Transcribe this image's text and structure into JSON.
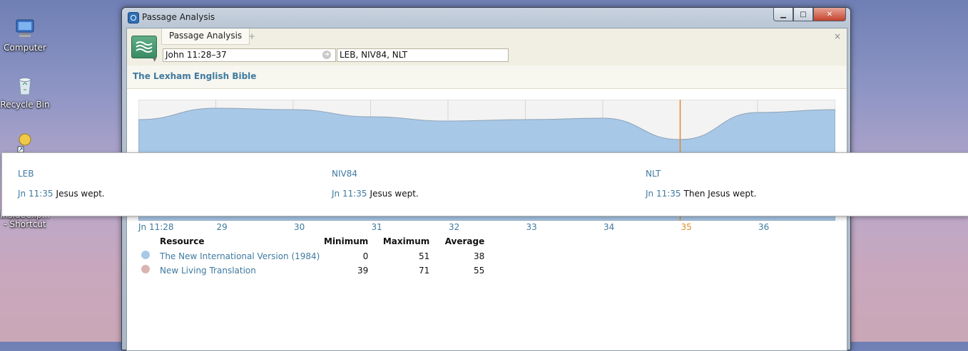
{
  "desktop": {
    "icons": [
      {
        "label": "Computer",
        "icon": "computer-icon"
      },
      {
        "label": "Recycle Bin",
        "icon": "recycle-bin-icon"
      },
      {
        "label": "InsideClip... - Shortcut",
        "icon": "shortcut-icon"
      }
    ]
  },
  "window": {
    "title": "Passage Analysis",
    "tab_label": "Passage Analysis",
    "tab_add": "+",
    "tab_close": "×",
    "reference_value": "John 11:28–37",
    "resources_value": "LEB, NIV84, NLT",
    "base_bible": "The Lexham English Bible"
  },
  "chart_data": {
    "type": "area",
    "x": [
      "Jn 11:28",
      "29",
      "30",
      "31",
      "32",
      "33",
      "34",
      "35",
      "36"
    ],
    "highlight": "35",
    "series": [
      {
        "name": "The New International Version (1984)",
        "color": "#a8c8e8",
        "minimum": 0,
        "maximum": 51,
        "average": 38
      },
      {
        "name": "New Living Translation",
        "color": "#d9b4b0",
        "minimum": 39,
        "maximum": 71,
        "average": 55
      }
    ],
    "grid": true
  },
  "legend": {
    "headers": {
      "resource": "Resource",
      "min": "Minimum",
      "max": "Maximum",
      "avg": "Average"
    },
    "rows": [
      {
        "name": "The New International Version (1984)",
        "color": "#a8c8e8",
        "min": "0",
        "max": "51",
        "avg": "38"
      },
      {
        "name": "New Living Translation",
        "color": "#d9b4b0",
        "min": "39",
        "max": "71",
        "avg": "55"
      }
    ]
  },
  "popup": {
    "columns": [
      {
        "header": "LEB",
        "ref": "Jn 11:35",
        "text": "Jesus wept."
      },
      {
        "header": "NIV84",
        "ref": "Jn 11:35",
        "text": "Jesus wept."
      },
      {
        "header": "NLT",
        "ref": "Jn 11:35",
        "text": "Then Jesus wept."
      }
    ]
  }
}
